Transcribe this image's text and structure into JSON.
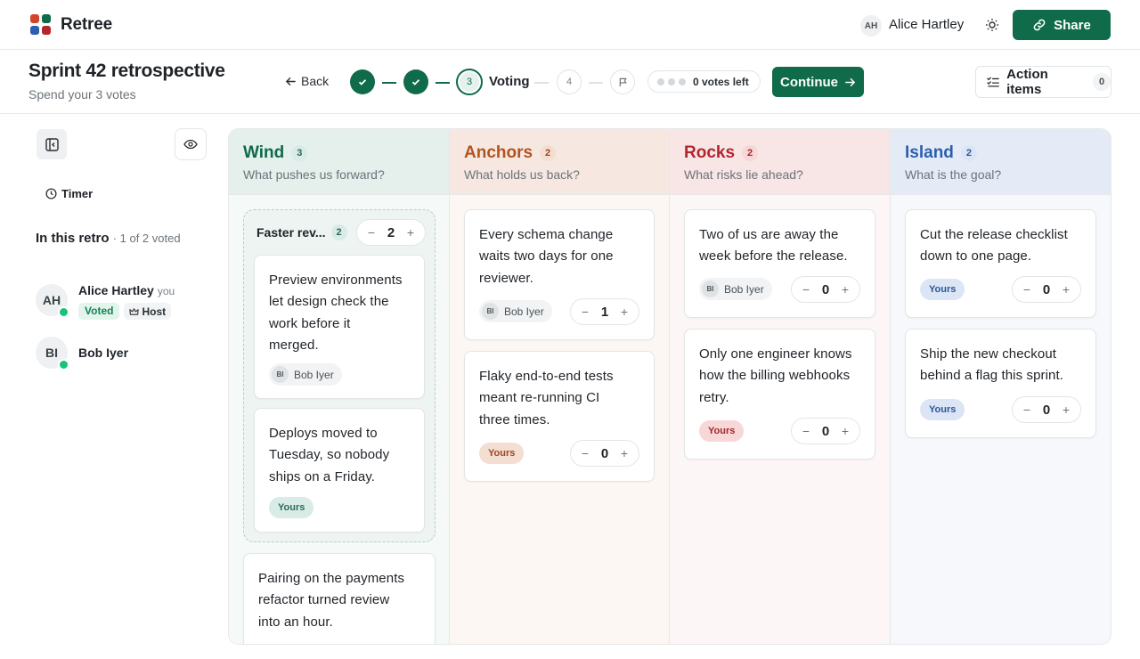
{
  "app": {
    "brand": "Retree",
    "user_initials": "AH",
    "user_name": "Alice Hartley",
    "share_label": "Share"
  },
  "header": {
    "title": "Sprint 42 retrospective",
    "subtitle": "Spend your 3 votes",
    "back_label": "Back",
    "steps": [
      {
        "state": "done",
        "label": ""
      },
      {
        "state": "done",
        "label": ""
      },
      {
        "state": "current",
        "label": "3"
      },
      {
        "state": "future",
        "label": "4"
      },
      {
        "state": "future-flag",
        "label": ""
      }
    ],
    "current_step_label": "Voting",
    "votes_left": "0 votes left",
    "continue_label": "Continue",
    "action_items_label": "Action items",
    "action_items_count": "0"
  },
  "sidebar": {
    "timer_label": "Timer",
    "retro_title": "In this retro",
    "retro_voted": "· 1 of 2 voted",
    "participants": [
      {
        "initials": "AH",
        "name": "Alice Hartley",
        "you": "you",
        "voted": "Voted",
        "host": "Host"
      },
      {
        "initials": "BI",
        "name": "Bob Iyer"
      }
    ]
  },
  "columns": [
    {
      "title": "Wind",
      "count": "3",
      "subtitle": "What pushes us forward?",
      "accent": "#0f6b4a",
      "header_bg": "#e5efec",
      "body_bg": "#f5f9f8",
      "yours_bg": "#d8ebe6",
      "yours_fg": "#2a6a58",
      "group": {
        "title": "Faster rev...",
        "count": "2",
        "votes": "2"
      },
      "cards": [
        {
          "text": "Preview environments\nlet design check the\nwork before it\nmerged.",
          "author": "Bob Iyer",
          "author_initials": "BI"
        },
        {
          "text": "Deploys moved to\nTuesday, so nobody\nships on a Friday.",
          "yours": "Yours"
        },
        {
          "text": "Pairing on the payments\nrefactor turned review\ninto an hour."
        }
      ]
    },
    {
      "title": "Anchors",
      "count": "2",
      "subtitle": "What holds us back?",
      "accent": "#b3541e",
      "header_bg": "#f6e8e1",
      "body_bg": "#fdf7f4",
      "yours_bg": "#f4ddd1",
      "yours_fg": "#9a4a22",
      "cards": [
        {
          "text": "Every schema change\nwaits two days for one\nreviewer.",
          "author": "Bob Iyer",
          "author_initials": "BI",
          "votes": "1"
        },
        {
          "text": "Flaky end-to-end tests\nmeant re-running CI\nthree times.",
          "yours": "Yours",
          "votes": "0"
        }
      ]
    },
    {
      "title": "Rocks",
      "count": "2",
      "subtitle": "What risks lie ahead?",
      "accent": "#b3262e",
      "header_bg": "#f8e5e5",
      "body_bg": "#fdf6f6",
      "yours_bg": "#f7d7d7",
      "yours_fg": "#a2262d",
      "cards": [
        {
          "text": "Two of us are away the\nweek before the release.",
          "author": "Bob Iyer",
          "author_initials": "BI",
          "votes": "0"
        },
        {
          "text": "Only one engineer knows\nhow the billing webhooks\nretry.",
          "yours": "Yours",
          "votes": "0"
        }
      ]
    },
    {
      "title": "Island",
      "count": "2",
      "subtitle": "What is the goal?",
      "accent": "#2b5fb0",
      "header_bg": "#e5ebf6",
      "body_bg": "#f6f8fc",
      "yours_bg": "#dbe5f5",
      "yours_fg": "#2d5799",
      "cards": [
        {
          "text": "Cut the release checklist\ndown to one page.",
          "yours": "Yours",
          "votes": "0"
        },
        {
          "text": "Ship the new checkout\nbehind a flag this sprint.",
          "yours": "Yours",
          "votes": "0"
        }
      ]
    }
  ]
}
